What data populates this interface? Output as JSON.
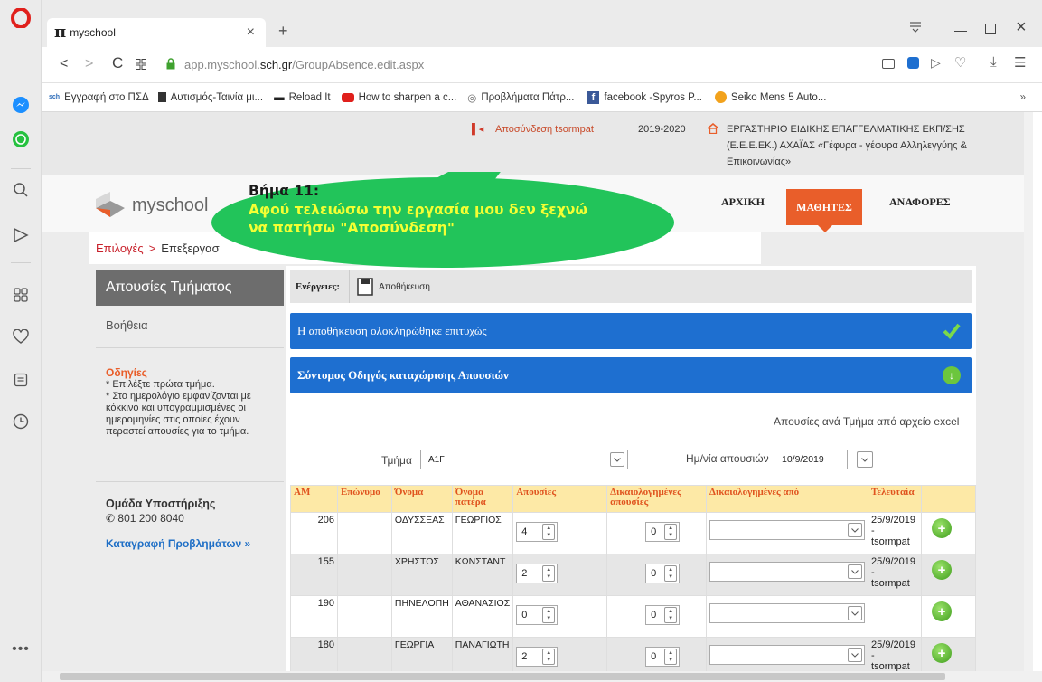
{
  "browser": {
    "tab_title": "myschool",
    "url_domain_prefix": "app.myschool.",
    "url_domain": "sch.gr",
    "url_path": "/GroupAbsence.edit.aspx"
  },
  "bookmarks": [
    {
      "label": "Εγγραφή στο ΠΣΔ",
      "icon": "sch-icon"
    },
    {
      "label": "Αυτισμός-Ταινία μι...",
      "icon": "file-icon"
    },
    {
      "label": "Reload It",
      "icon": "flag-icon"
    },
    {
      "label": "How to sharpen a c...",
      "icon": "youtube-icon"
    },
    {
      "label": "Προβλήματα Πάτρ...",
      "icon": "globe-icon"
    },
    {
      "label": "facebook -Spyros P...",
      "icon": "facebook-icon"
    },
    {
      "label": "Seiko Mens 5 Auto...",
      "icon": "leaf-icon"
    }
  ],
  "topinfo": {
    "logout": "Αποσύνδεση tsormpat",
    "year": "2019-2020",
    "school": "ΕΡΓΑΣΤΗΡΙΟ ΕΙΔΙΚΗΣ ΕΠΑΓΓΕΛΜΑΤΙΚΗΣ ΕΚΠ/ΣΗΣ",
    "school2": "(Ε.Ε.Ε.ΕΚ.) ΑΧΑΪΑΣ «Γέφυρα - γέφυρα Αλληλεγγύης &",
    "school3": "Επικοινωνίας»"
  },
  "nav": {
    "logo": "myschool",
    "home": "ΑΡΧΙΚΗ",
    "students": "ΜΑΘΗΤΕΣ",
    "reports": "ΑΝΑΦΟΡΕΣ"
  },
  "breadcrumb": {
    "options": "Επιλογές",
    "sep": ">",
    "current": "Επεξεργασ"
  },
  "callout": {
    "title": "Βήμα 11:",
    "line1": "Αφού τελειώσω την εργασία μου δεν ξεχνώ",
    "line2": "να πατήσω \"Αποσύνδεση\""
  },
  "left": {
    "title": "Απουσίες Τμήματος",
    "help": "Βοήθεια",
    "instructions_title": "Οδηγίες",
    "instr1": "* Επιλέξτε πρώτα τμήμα.",
    "instr2": "* Στο ημερολόγιο εμφανίζονται με",
    "instr3": "κόκκινο και υπογραμμισμένες οι",
    "instr4": "ημερομηνίες στις οποίες έχουν",
    "instr5": "περαστεί απουσίες για το τμήμα.",
    "support_title": "Ομάδα Υποστήριξης",
    "phone": "801 200 8040",
    "report_link": "Καταγραφή Προβλημάτων »"
  },
  "main": {
    "actions_label": "Ενέργειες:",
    "save_label": "Αποθήκευση",
    "success_msg": "Η αποθήκευση ολοκληρώθηκε επιτυχώς",
    "guide_msg": "Σύντομος Οδηγός καταχώρισης Απουσιών",
    "excel_link": "Απουσίες ανά Τμήμα από αρχείο excel",
    "dept_label": "Τμήμα",
    "dept_value": "Α1Γ",
    "date_label": "Ημ/νία απουσιών",
    "date_value": "10/9/2019"
  },
  "table": {
    "headers": [
      "ΑΜ",
      "Επώνυμο",
      "Όνομα",
      "Όνομα πατέρα",
      "Απουσίες",
      "Δικαιολογημένες απουσίες",
      "Δικαιολογημένες από",
      "Τελευταία"
    ],
    "rows": [
      {
        "am": "206",
        "surname": "",
        "name": "ΟΔΥΣΣΕΑΣ",
        "father": "ΓΕΩΡΓΙΟΣ",
        "absences": "4",
        "justified": "0",
        "last_date": "25/9/2019",
        "last_dash": "-",
        "last_user": "tsormpat"
      },
      {
        "am": "155",
        "surname": "",
        "name": "ΧΡΗΣΤΟΣ",
        "father": "ΚΩΝΣΤΑΝΤ",
        "absences": "2",
        "justified": "0",
        "last_date": "25/9/2019",
        "last_dash": "-",
        "last_user": "tsormpat"
      },
      {
        "am": "190",
        "surname": "",
        "name": "ΠΗΝΕΛΟΠΗ",
        "father": "ΑΘΑΝΑΣΙΟΣ",
        "absences": "0",
        "justified": "0",
        "last_date": "",
        "last_dash": "",
        "last_user": ""
      },
      {
        "am": "180",
        "surname": "",
        "name": "ΓΕΩΡΓΙΑ",
        "father": "ΠΑΝΑΓΙΩΤΗ",
        "absences": "2",
        "justified": "0",
        "last_date": "25/9/2019",
        "last_dash": "-",
        "last_user": "tsormpat"
      }
    ]
  },
  "colors": {
    "accent": "#e95e2a",
    "blue": "#1e6fd0",
    "header_bg": "#fde9a6",
    "callout": "#22c45a",
    "callout_text": "#f4ff33"
  }
}
